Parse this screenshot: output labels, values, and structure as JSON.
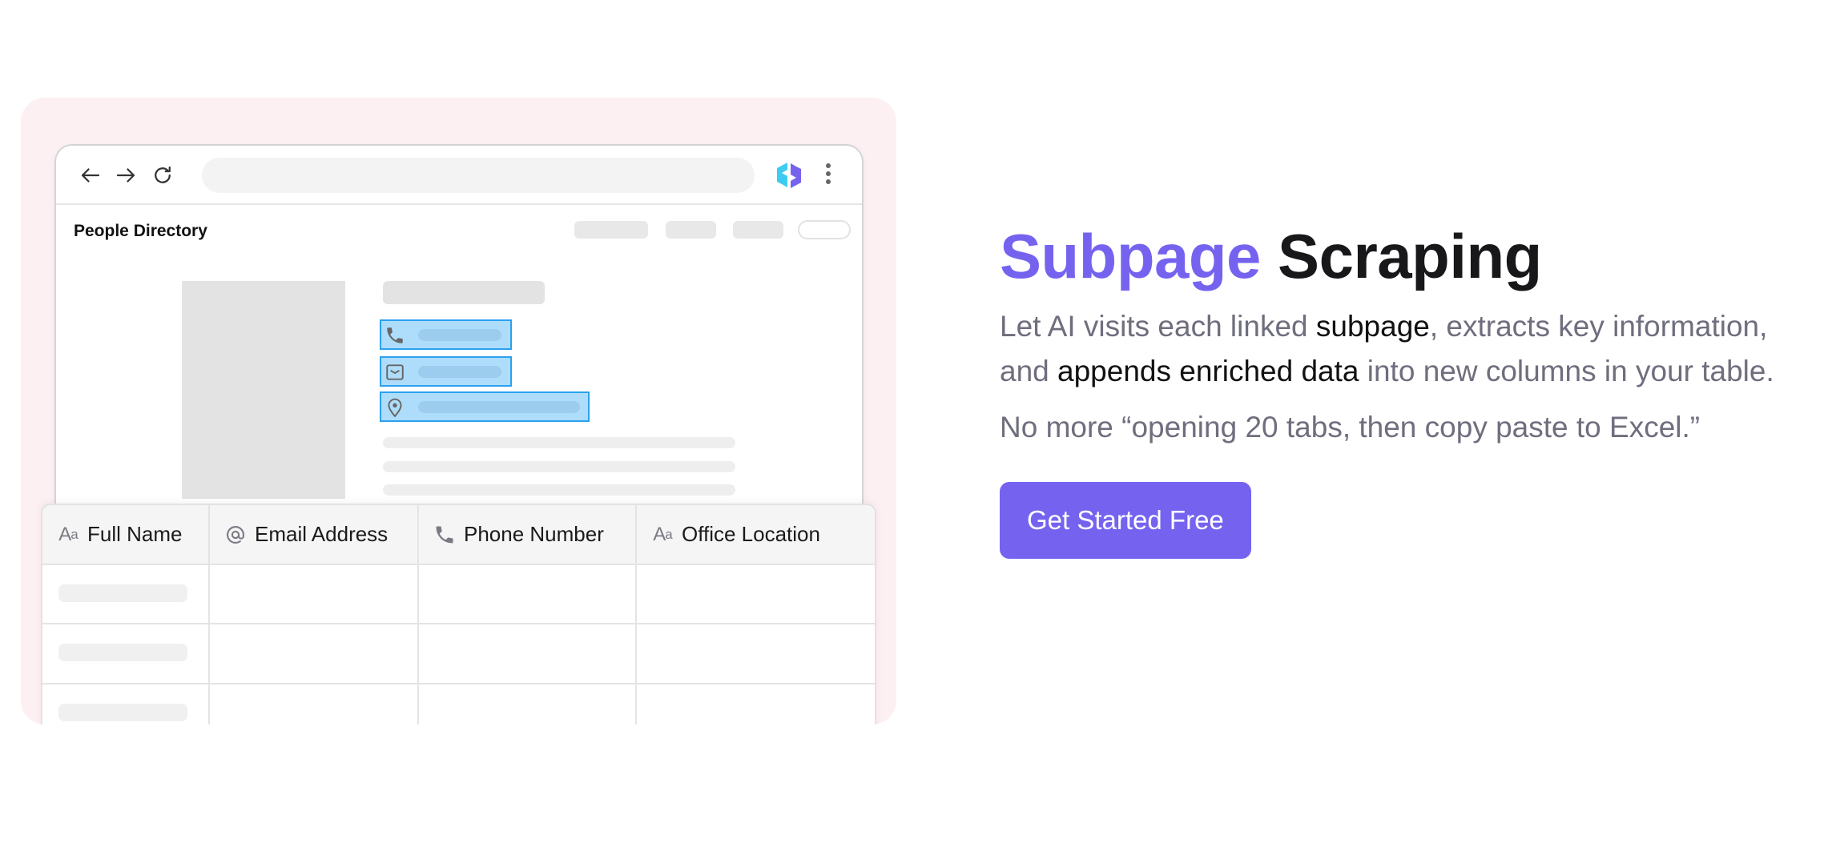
{
  "illustration": {
    "browser": {
      "nav": {
        "back_icon": "arrow-left-icon",
        "forward_icon": "arrow-right-icon",
        "reload_icon": "reload-icon",
        "url": "",
        "extension_icon": "extension-logo-icon",
        "menu_icon": "kebab-menu-icon"
      },
      "site_title": "People Directory",
      "highlighted_fields": [
        {
          "icon": "phone-icon"
        },
        {
          "icon": "mail-icon"
        },
        {
          "icon": "location-pin-icon"
        }
      ]
    },
    "table": {
      "columns": [
        {
          "icon": "text-type-icon",
          "icon_text": "A",
          "icon_small": "a",
          "label": "Full Name"
        },
        {
          "icon": "at-sign-icon",
          "label": "Email Address"
        },
        {
          "icon": "phone-icon",
          "label": "Phone Number"
        },
        {
          "icon": "text-type-icon",
          "icon_text": "A",
          "icon_small": "a",
          "label": "Office Location"
        }
      ],
      "rows": [
        [
          "",
          "",
          "",
          ""
        ],
        [
          "",
          "",
          "",
          ""
        ],
        [
          "",
          "",
          "",
          ""
        ]
      ]
    }
  },
  "feature": {
    "title_accent": "Subpage",
    "title_rest": "Scraping",
    "description": {
      "p1": "Let AI visits each linked ",
      "em1": "subpage",
      "p2": ", extracts key information, and ",
      "em2": "appends enriched data",
      "p3": " into new columns in your table."
    },
    "note": "No more “opening 20 tabs, then copy paste to Excel.”",
    "cta_label": "Get Started Free"
  },
  "colors": {
    "accent": "#7563F0",
    "highlight_border": "#2AA1EE",
    "highlight_fill": "#AEDDFB",
    "card_bg": "#FDF0F2"
  }
}
